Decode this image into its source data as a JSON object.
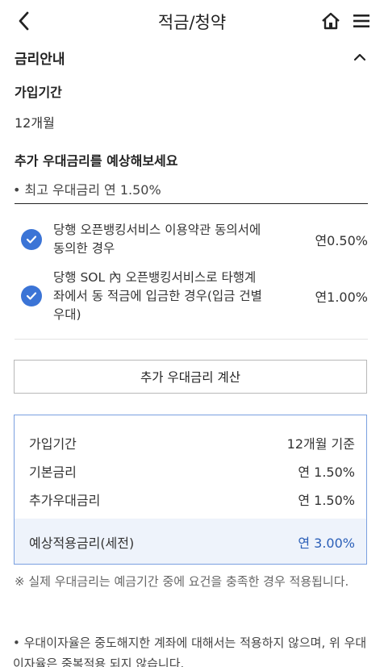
{
  "header": {
    "title": "적금/청약",
    "back_icon": "chevron-left-icon",
    "home_icon": "home-icon",
    "menu_icon": "hamburger-menu-icon"
  },
  "section": {
    "title": "금리안내",
    "toggle_icon": "chevron-up-icon"
  },
  "term": {
    "label": "가입기간",
    "value": "12개월"
  },
  "bonus": {
    "heading": "추가 우대금리를 예상해보세요",
    "max_rate": "• 최고 우대금리 연 1.50%",
    "options": [
      {
        "text": "당행 오픈뱅킹서비스 이용약관 동의서에 동의한 경우",
        "rate": "연0.50%",
        "checked": true
      },
      {
        "text": "당행 SOL 內 오픈뱅킹서비스로 타행계좌에서 동 적금에 입금한 경우(입금 건별 우대)",
        "rate": "연1.00%",
        "checked": true
      }
    ],
    "calc_button": "추가 우대금리 계산"
  },
  "summary": {
    "rows": [
      {
        "label": "가입기간",
        "value": "12개월 기준"
      },
      {
        "label": "기본금리",
        "value": "연 1.50%"
      },
      {
        "label": "추가우대금리",
        "value": "연 1.50%"
      }
    ],
    "total": {
      "label": "예상적용금리(세전)",
      "value": "연 3.00%"
    }
  },
  "notes": {
    "note1": "※ 실제 우대금리는 예금기간 중에 요건을 충족한 경우 적용됩니다.",
    "note2": "• 우대이자율은 중도해지한 계좌에 대해서는 적용하지 않으며, 위 우대이자율은 중복적용 되지 않습니다."
  },
  "colors": {
    "accent": "#3b74d6",
    "total_blue": "#2b5fb8",
    "summary_border": "#7aa0e0"
  }
}
